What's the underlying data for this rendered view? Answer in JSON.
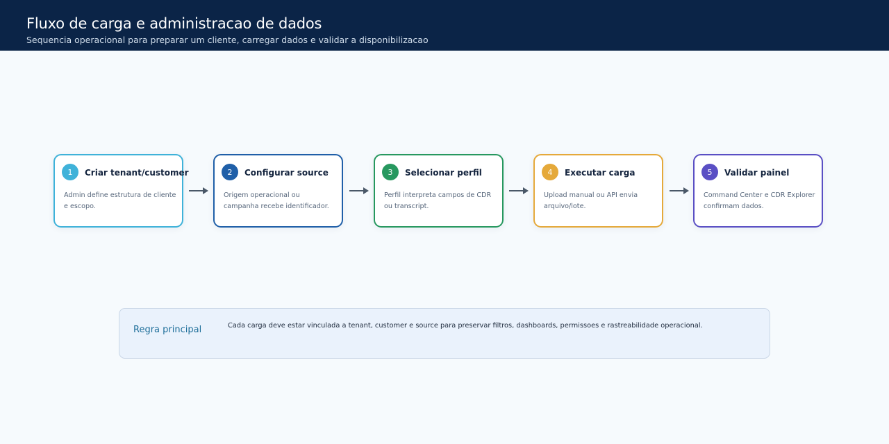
{
  "header": {
    "title": "Fluxo de carga e administracao de dados",
    "subtitle": "Sequencia operacional para preparar um cliente, carregar dados e validar a disponibilizacao"
  },
  "steps": [
    {
      "number": "1",
      "title": "Criar tenant/customer",
      "description": "Admin define estrutura de cliente e escopo.",
      "color": "#3fb2d9"
    },
    {
      "number": "2",
      "title": "Configurar source",
      "description": "Origem operacional ou campanha recebe identificador.",
      "color": "#1f5fa8"
    },
    {
      "number": "3",
      "title": "Selecionar perfil",
      "description": "Perfil interpreta campos de CDR ou transcript.",
      "color": "#27985f"
    },
    {
      "number": "4",
      "title": "Executar carga",
      "description": "Upload manual ou API envia arquivo/lote.",
      "color": "#e5a93a"
    },
    {
      "number": "5",
      "title": "Validar painel",
      "description": "Command Center e CDR Explorer confirmam dados.",
      "color": "#5a4fc4"
    }
  ],
  "arrow_color": "#4a5868",
  "rule": {
    "label": "Regra principal",
    "text": "Cada carga deve estar vinculada a tenant, customer e source para preservar filtros, dashboards, permissoes e rastreabilidade operacional."
  }
}
